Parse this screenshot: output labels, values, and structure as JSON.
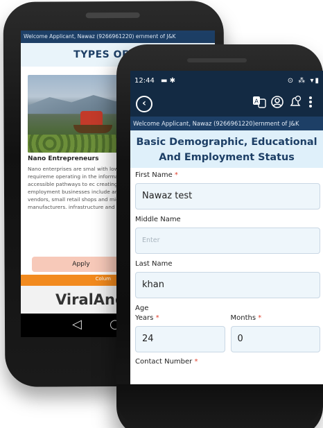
{
  "back_phone": {
    "welcome": "Welcome Applicant, Nawaz (9266961220) ernment of J&K",
    "title": "TYPES OF ENTE",
    "card_title": "Nano Entrepreneurs",
    "card_text": "Nano enterprises are smal with low capital requireme operating in the informal s accessible pathways to ec creating self-employment businesses include and ta vendors, small retail shops and micro-manufacturers. infrastructure and financia",
    "apply_label": "Apply",
    "footer_text": "Colum",
    "watermark": "ViralAndro",
    "nav": {
      "back": "◁",
      "home": "○"
    }
  },
  "front_phone": {
    "status": {
      "time": "12:44",
      "left_icons": "▬ ✱",
      "right_icons": "⊙ ⁂ ▾▮"
    },
    "app_bar": {
      "back": "‹"
    },
    "welcome": "Welcome Applicant, Nawaz (9266961220)ernment of J&K",
    "section_title": "Basic Demographic, Educational And Employment Status",
    "form": {
      "first_name_label": "First Name",
      "first_name_value": "Nawaz test",
      "middle_name_label": "Middle Name",
      "middle_name_placeholder": "Enter",
      "last_name_label": "Last Name",
      "last_name_value": "khan",
      "age_label": "Age",
      "years_label": "Years",
      "years_value": "24",
      "months_label": "Months",
      "months_value": "0",
      "contact_label": "Contact Number"
    },
    "icons": [
      "translate-icon",
      "profile-icon",
      "notification-clock-icon",
      "more-vert-icon"
    ]
  }
}
